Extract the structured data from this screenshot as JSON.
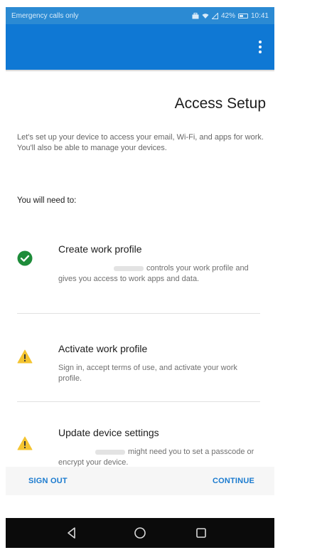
{
  "status_bar": {
    "carrier": "Emergency calls only",
    "battery": "42%",
    "time": "10:41"
  },
  "toolbar": {
    "menu_icon": "more-vert-icon"
  },
  "content": {
    "title": "Access Setup",
    "intro": "Let's set up your device to access your email, Wi-Fi, and apps for work. You'll also be able to manage your devices.",
    "need_label": "You will need to:"
  },
  "steps": [
    {
      "title": "Create work profile",
      "description": "controls your work profile and gives you access to work apps and data.",
      "status": "complete",
      "icon": "check-circle-icon",
      "color": "#1e8c3a"
    },
    {
      "title": "Activate work profile",
      "description": "Sign in, accept terms of use, and activate your work profile.",
      "status": "warning",
      "icon": "warning-icon",
      "color": "#f4c430"
    },
    {
      "title": "Update device settings",
      "description": "might need you to set a passcode or encrypt your device.",
      "status": "warning",
      "icon": "warning-icon",
      "color": "#f4c430"
    }
  ],
  "actions": {
    "sign_out": "SIGN OUT",
    "continue": "CONTINUE"
  },
  "nav": {
    "back_icon": "back-triangle-icon",
    "home_icon": "home-circle-icon",
    "recents_icon": "recents-square-icon"
  },
  "colors": {
    "toolbar": "#0f78d4",
    "status_bar": "#2b8ad3",
    "accent": "#1b7bcf"
  }
}
